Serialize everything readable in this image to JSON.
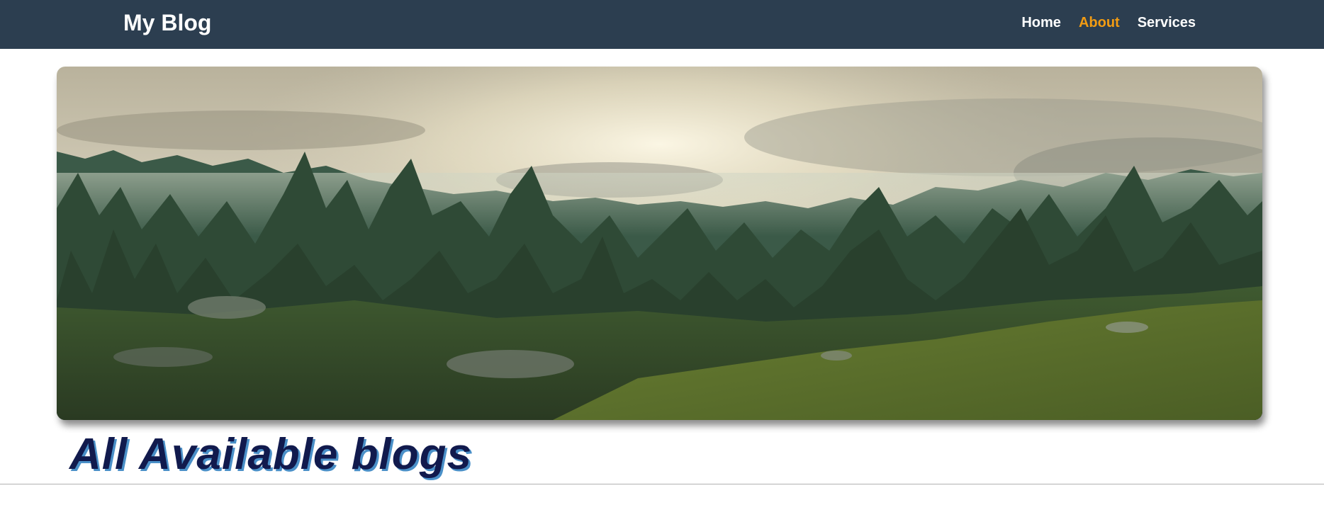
{
  "navbar": {
    "brand": "My Blog",
    "links": [
      {
        "label": "Home",
        "active": false
      },
      {
        "label": "About",
        "active": true
      },
      {
        "label": "Services",
        "active": false
      }
    ],
    "background_color": "#2c3e50",
    "active_color": "#f39c12"
  },
  "hero": {
    "image_subject": "forest-landscape-image"
  },
  "main": {
    "heading": "All Available blogs",
    "heading_color": "#111a4d"
  }
}
